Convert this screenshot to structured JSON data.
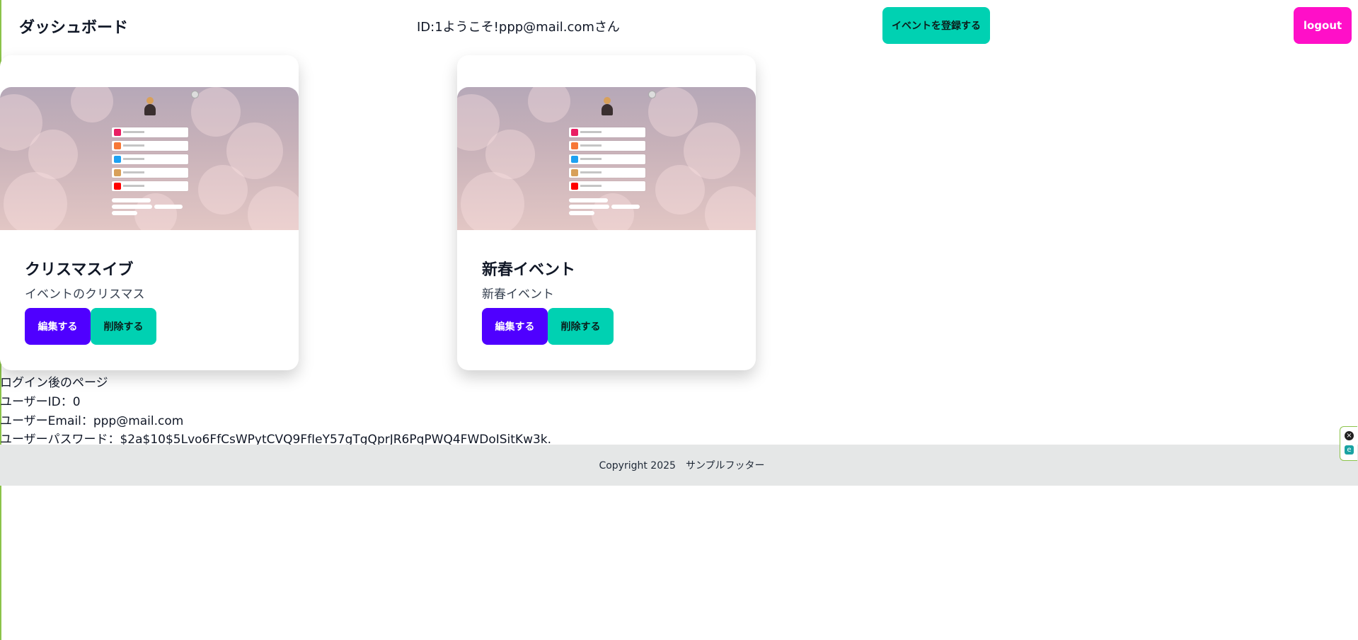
{
  "header": {
    "brand": "ダッシュボード",
    "welcome": "ID:1ようこそ!ppp@mail.comさん",
    "register_button": "イベントを登録する",
    "logout_button": "logout"
  },
  "events": [
    {
      "title": "クリスマスイブ",
      "description": "イベントのクリスマス",
      "edit_label": "編集する",
      "delete_label": "削除する"
    },
    {
      "title": "新春イベント",
      "description": "新春イベント",
      "edit_label": "編集する",
      "delete_label": "削除する"
    }
  ],
  "info": {
    "page_label": "ログイン後のページ",
    "user_id": "ユーザーID：0",
    "user_email": "ユーザーEmail：ppp@mail.com",
    "user_password": "ユーザーパスワード：$2a$10$5Lvo6FfCsWPytCVQ9FfIeY57gTgQprJR6PqPWQ4FWDoISitKw3k."
  },
  "footer": {
    "text": "Copyright 2025　サンプルフッター"
  },
  "colors": {
    "teal": "#00d1b2",
    "purple": "#4f00ff",
    "magenta": "#ff0fc8",
    "footer_bg": "#e5e7e7"
  },
  "icons": [
    "close-icon",
    "extension-icon"
  ]
}
